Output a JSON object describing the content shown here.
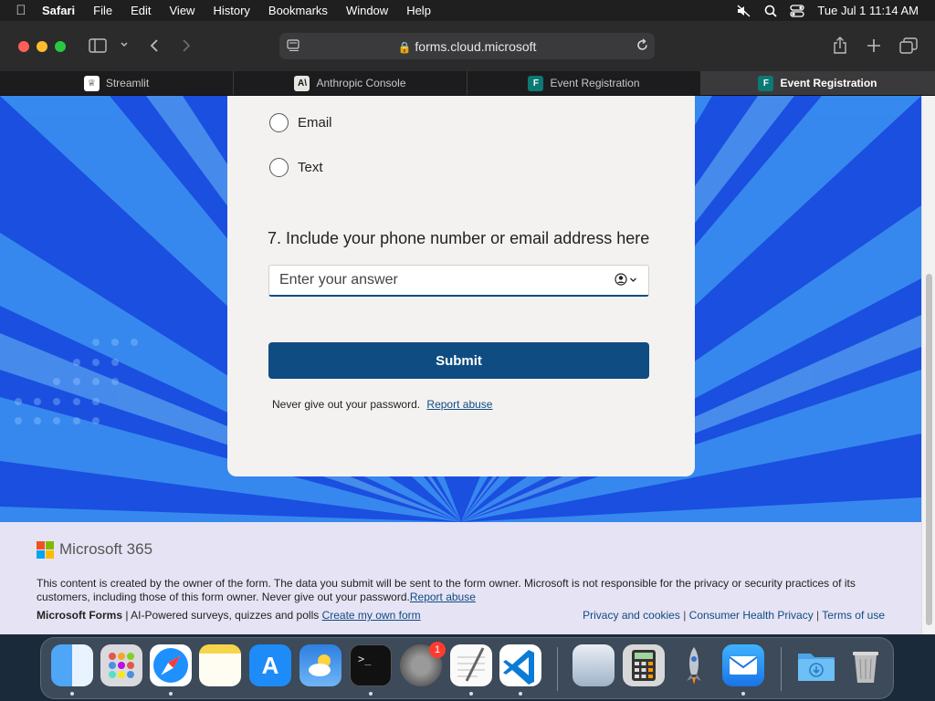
{
  "menubar": {
    "app": "Safari",
    "items": [
      "File",
      "Edit",
      "View",
      "History",
      "Bookmarks",
      "Window",
      "Help"
    ],
    "datetime": "Tue Jul 1  11:14 AM"
  },
  "toolbar": {
    "url": "forms.cloud.microsoft"
  },
  "tabs": [
    {
      "label": "Streamlit",
      "icon": "streamlit-icon"
    },
    {
      "label": "Anthropic Console",
      "icon": "anthropic-icon"
    },
    {
      "label": "Event Registration",
      "icon": "forms-icon"
    },
    {
      "label": "Event Registration",
      "icon": "forms-icon",
      "active": true
    }
  ],
  "form": {
    "options": [
      "Email",
      "Text"
    ],
    "question": "7.  Include your phone number or email address here",
    "answer_placeholder": "Enter your answer",
    "submit_label": "Submit",
    "password_note": "Never give out your password.",
    "report_abuse": "Report abuse"
  },
  "footer": {
    "brand": "Microsoft 365",
    "disclaimer": "This content is created by the owner of the form. The data you submit will be sent to the form owner. Microsoft is not responsible for the privacy or security practices of its customers, including those of this form owner. Never give out your password.",
    "report_abuse": "Report abuse",
    "product": "Microsoft Forms",
    "tagline": " | AI-Powered surveys, quizzes and polls ",
    "create_link": "Create my own form",
    "privacy": "Privacy and cookies",
    "health": "Consumer Health Privacy",
    "terms": "Terms of use",
    "sep": " | "
  },
  "dock": {
    "apps": [
      "finder-icon",
      "launchpad-icon",
      "safari-icon",
      "notes-icon",
      "app-store-icon",
      "weather-icon",
      "terminal-icon",
      "system-settings-icon",
      "textedit-icon",
      "vscode-icon",
      "preview-icon",
      "calculator-icon",
      "rocket-icon",
      "mail-icon",
      "downloads-icon",
      "trash-icon"
    ],
    "settings_badge": "1"
  },
  "colors": {
    "accent": "#0f4c81",
    "background_blue": "#1a4fe0",
    "footer_bg": "#e6e3f4"
  }
}
